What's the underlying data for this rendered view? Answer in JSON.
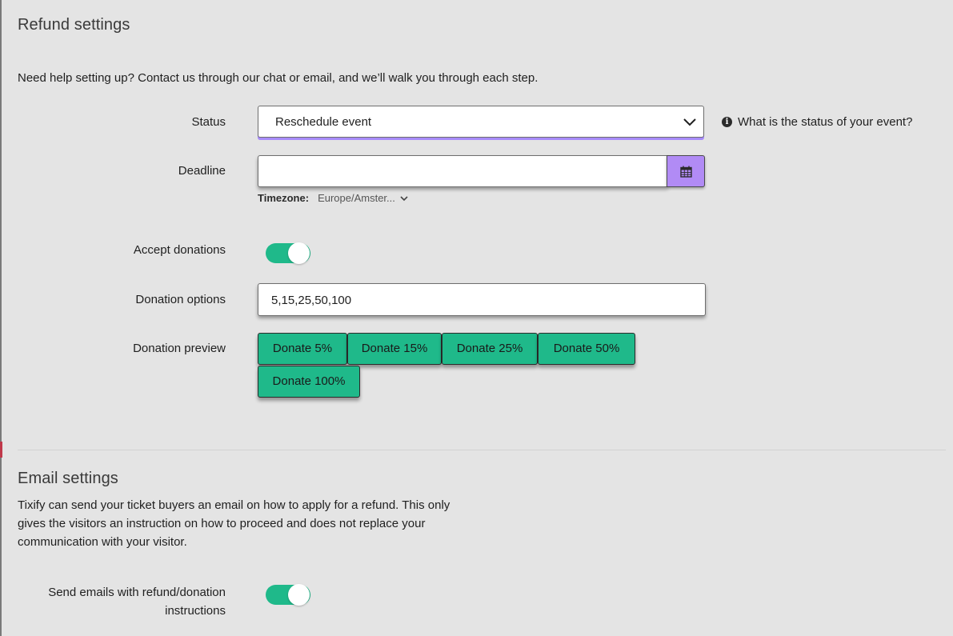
{
  "refund": {
    "title": "Refund settings",
    "help_text": "Need help setting up? Contact us through our chat or email, and we’ll walk you through each step.",
    "status": {
      "label": "Status",
      "value": "Reschedule event",
      "hint": "What is the status of your event?"
    },
    "deadline": {
      "label": "Deadline",
      "value": "",
      "timezone_label": "Timezone:",
      "timezone_value": "Europe/Amster..."
    },
    "accept_donations": {
      "label": "Accept donations",
      "enabled": true
    },
    "donation_options": {
      "label": "Donation options",
      "value": "5,15,25,50,100"
    },
    "donation_preview": {
      "label": "Donation preview",
      "buttons": [
        "Donate 5%",
        "Donate 15%",
        "Donate 25%",
        "Donate 50%",
        "Donate 100%"
      ]
    }
  },
  "email": {
    "title": "Email settings",
    "description": "Tixify can send your ticket buyers an email on how to apply for a refund. This only gives the visitors an instruction on how to proceed and does not replace your communication with your visitor.",
    "send_emails": {
      "label_line1": "Send emails with refund/donation",
      "label_line2": "instructions",
      "enabled": true
    }
  },
  "colors": {
    "accent_green": "#1fb98a",
    "accent_purple": "#b18bf5",
    "background": "#e4e4e4"
  },
  "icons": {
    "status_chevron": "chevron-down-icon",
    "hint": "info-icon",
    "calendar": "calendar-icon",
    "timezone_chevron": "chevron-down-icon"
  }
}
